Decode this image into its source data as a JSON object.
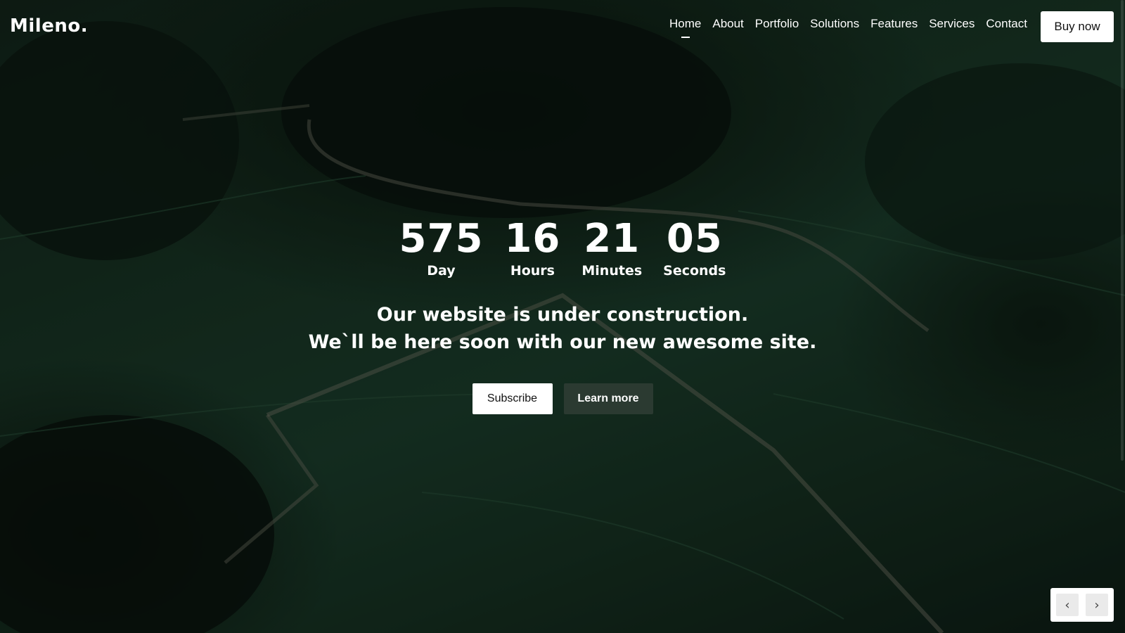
{
  "brand": {
    "logo": "Mileno."
  },
  "nav": {
    "items": [
      {
        "label": "Home",
        "active": true
      },
      {
        "label": "About"
      },
      {
        "label": "Portfolio"
      },
      {
        "label": "Solutions"
      },
      {
        "label": "Features"
      },
      {
        "label": "Services"
      },
      {
        "label": "Contact"
      }
    ],
    "cta_label": "Buy now"
  },
  "countdown": [
    {
      "value": "575",
      "label": "Day"
    },
    {
      "value": "16",
      "label": "Hours"
    },
    {
      "value": "21",
      "label": "Minutes"
    },
    {
      "value": "05",
      "label": "Seconds"
    }
  ],
  "hero": {
    "line1": "Our website is under construction.",
    "line2": "We`ll be here soon with our new awesome site.",
    "subscribe_label": "Subscribe",
    "learn_more_label": "Learn more"
  },
  "slider": {
    "prev_icon": "chevron-left-icon",
    "next_icon": "chevron-right-icon"
  },
  "colors": {
    "background_tint": "#1b3a28",
    "button_dark": "#2b3a31"
  }
}
